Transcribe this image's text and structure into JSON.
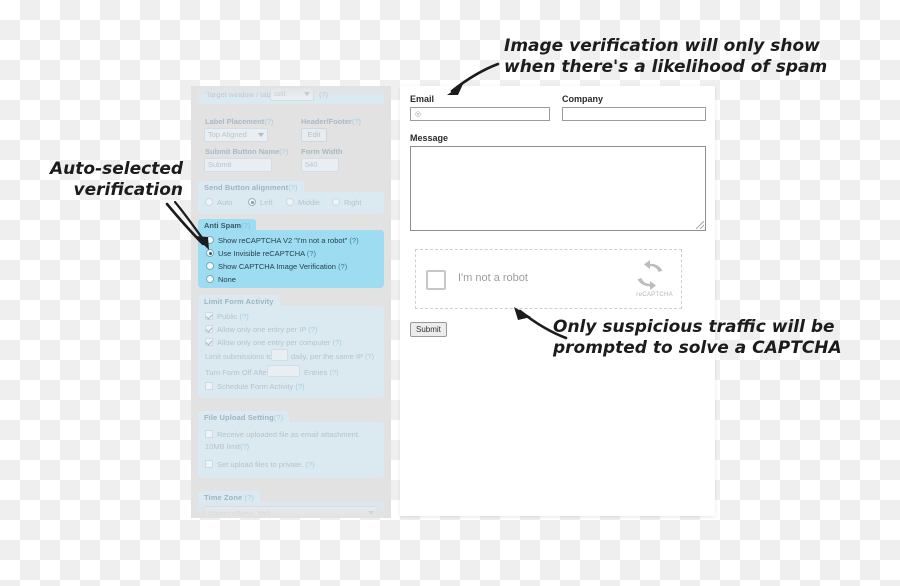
{
  "annotations": {
    "top": "Image verification will only show\nwhen there's a likelihood of spam",
    "left": "Auto-selected\nverification",
    "bottom": "Only suspicious traffic will be\nprompted to solve a CAPTCHA"
  },
  "settings_panel": {
    "target_window": {
      "label": "Target window / tab:",
      "value": "self",
      "help": "(?)"
    },
    "label_placement": {
      "label": "Label Placement",
      "help": "(?)",
      "value": "Top Aligned"
    },
    "header_footer": {
      "label": "Header/Footer",
      "help": "(?)",
      "button": "Edit"
    },
    "submit_button_name": {
      "label": "Submit Button Name",
      "help": "(?)",
      "value": "Submit"
    },
    "form_width": {
      "label": "Form Width",
      "value": "540"
    },
    "send_button_alignment": {
      "legend": "Send Button alignment",
      "help": "(?)",
      "options": [
        {
          "label": "Auto",
          "selected": false
        },
        {
          "label": "Left",
          "selected": true
        },
        {
          "label": "Middle",
          "selected": false
        },
        {
          "label": "Right",
          "selected": false
        }
      ]
    },
    "anti_spam": {
      "legend": "Anti Spam",
      "help": "(?)",
      "highlight_color": "#9edcf2",
      "options": [
        {
          "label": "Show reCAPTCHA V2 \"I'm not a robot\"",
          "help": "(?)",
          "selected": false
        },
        {
          "label": "Use Invisible reCAPTCHA",
          "help": "(?)",
          "selected": true
        },
        {
          "label": "Show CAPTCHA Image Verification",
          "help": "(?)",
          "selected": false
        },
        {
          "label": "None",
          "help": "",
          "selected": false
        }
      ]
    },
    "limit_form_activity": {
      "legend": "Limit Form Activity",
      "checkboxes": [
        {
          "label": "Public",
          "help": "(?)",
          "checked": true
        },
        {
          "label": "Allow only one entry per IP",
          "help": "(?)",
          "checked": true
        },
        {
          "label": "Allow only one entry per computer",
          "help": "(?)",
          "checked": true
        }
      ],
      "limit_submissions": {
        "prefix": "Limit submissions to",
        "value": "",
        "suffix": "daily, per the same IP",
        "help": "(?)"
      },
      "turn_form_off": {
        "prefix": "Turn Form Off After",
        "value": "",
        "suffix": "Entries",
        "help": "(?)"
      },
      "schedule": {
        "label": "Schedule Form Activity",
        "help": "(?)",
        "checked": false
      }
    },
    "file_upload_setting": {
      "legend": "File Upload Setting",
      "help": "(?)",
      "checkboxes": [
        {
          "label_line1": "Receive uploaded file as email attachment.",
          "label_line2": "10MB limit",
          "help": "(?)",
          "checked": false
        },
        {
          "label_line1": "Set upload files to private.",
          "label_line2": "",
          "help": "(?)",
          "checked": false
        }
      ]
    },
    "time_zone": {
      "legend": "Time Zone",
      "help": "(?)",
      "value": "America/New_York"
    }
  },
  "form_preview": {
    "fields": [
      {
        "label": "Email",
        "value": "",
        "icon": "at-icon"
      },
      {
        "label": "Company",
        "value": ""
      },
      {
        "label": "Message",
        "value": ""
      }
    ],
    "email_label": "Email",
    "company_label": "Company",
    "message_label": "Message",
    "recaptcha": {
      "checkbox_label": "I'm not a robot",
      "brand": "reCAPTCHA",
      "icon": "recaptcha-logo-icon"
    },
    "submit_label": "Submit"
  }
}
